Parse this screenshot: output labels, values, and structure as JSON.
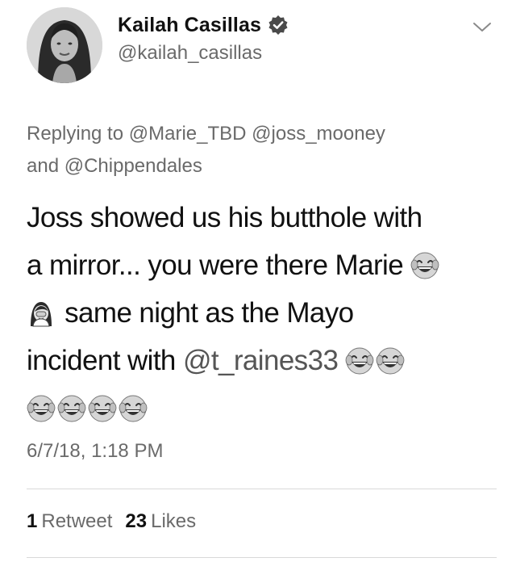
{
  "author": {
    "display_name": "Kailah Casillas",
    "handle": "@kailah_casillas",
    "verified": true,
    "avatar_icon": "profile-photo"
  },
  "menu_icon": "chevron-down-icon",
  "reply_context": {
    "prefix": "Replying to",
    "mentions": [
      "@Marie_TBD",
      "@joss_mooney",
      "@Chippendales"
    ],
    "conjunction": "and"
  },
  "tweet": {
    "line1": "Joss showed us his butthole with",
    "line2": "a mirror... you were there Marie",
    "line3": "same night as the Mayo",
    "line4_text": "incident with",
    "line4_mention": "@t_raines33",
    "emojis": {
      "laughing": "face-with-tears-of-joy-icon",
      "shrug": "person-facepalming-icon"
    }
  },
  "timestamp": "6/7/18, 1:18 PM",
  "stats": {
    "retweets_count": "1",
    "retweets_label": "Retweet",
    "likes_count": "23",
    "likes_label": "Likes"
  },
  "colors": {
    "text": "#111111",
    "secondary": "#6a6a6a",
    "divider": "#d9d9d9",
    "background": "#ffffff"
  }
}
